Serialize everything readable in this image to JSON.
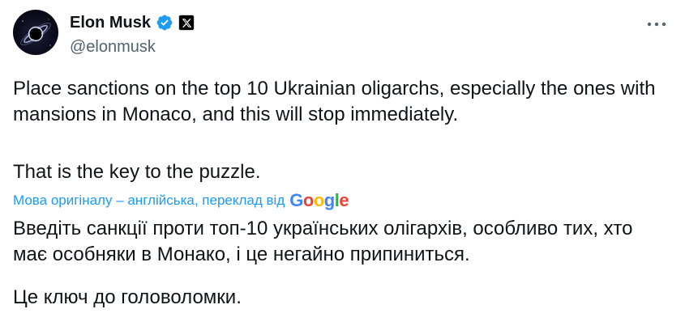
{
  "author": {
    "display_name": "Elon Musk",
    "handle": "@elonmusk",
    "verified_icon": "verified-badge-icon",
    "affiliation_icon": "x-logo-icon",
    "avatar": "avatar-image"
  },
  "tweet": {
    "paragraph_1": "Place sanctions on the top 10 Ukrainian oligarchs, especially the ones with mansions in Monaco, and this will stop immediately.",
    "paragraph_2": "That is the key to the puzzle."
  },
  "translation": {
    "label": "Мова оригіналу – англійська, переклад від",
    "provider": "Google",
    "paragraph_1": "Введіть санкції проти топ-10 українських олігархів, особливо тих, хто має особняки в Монако, і це негайно припиниться.",
    "paragraph_2": "Це ключ до головоломки."
  },
  "menu": {
    "icon": "more-horizontal-icon"
  },
  "colors": {
    "text": "#0f1419",
    "secondary": "#536471",
    "link": "#1d9bf0",
    "verified": "#1d9bf0"
  }
}
